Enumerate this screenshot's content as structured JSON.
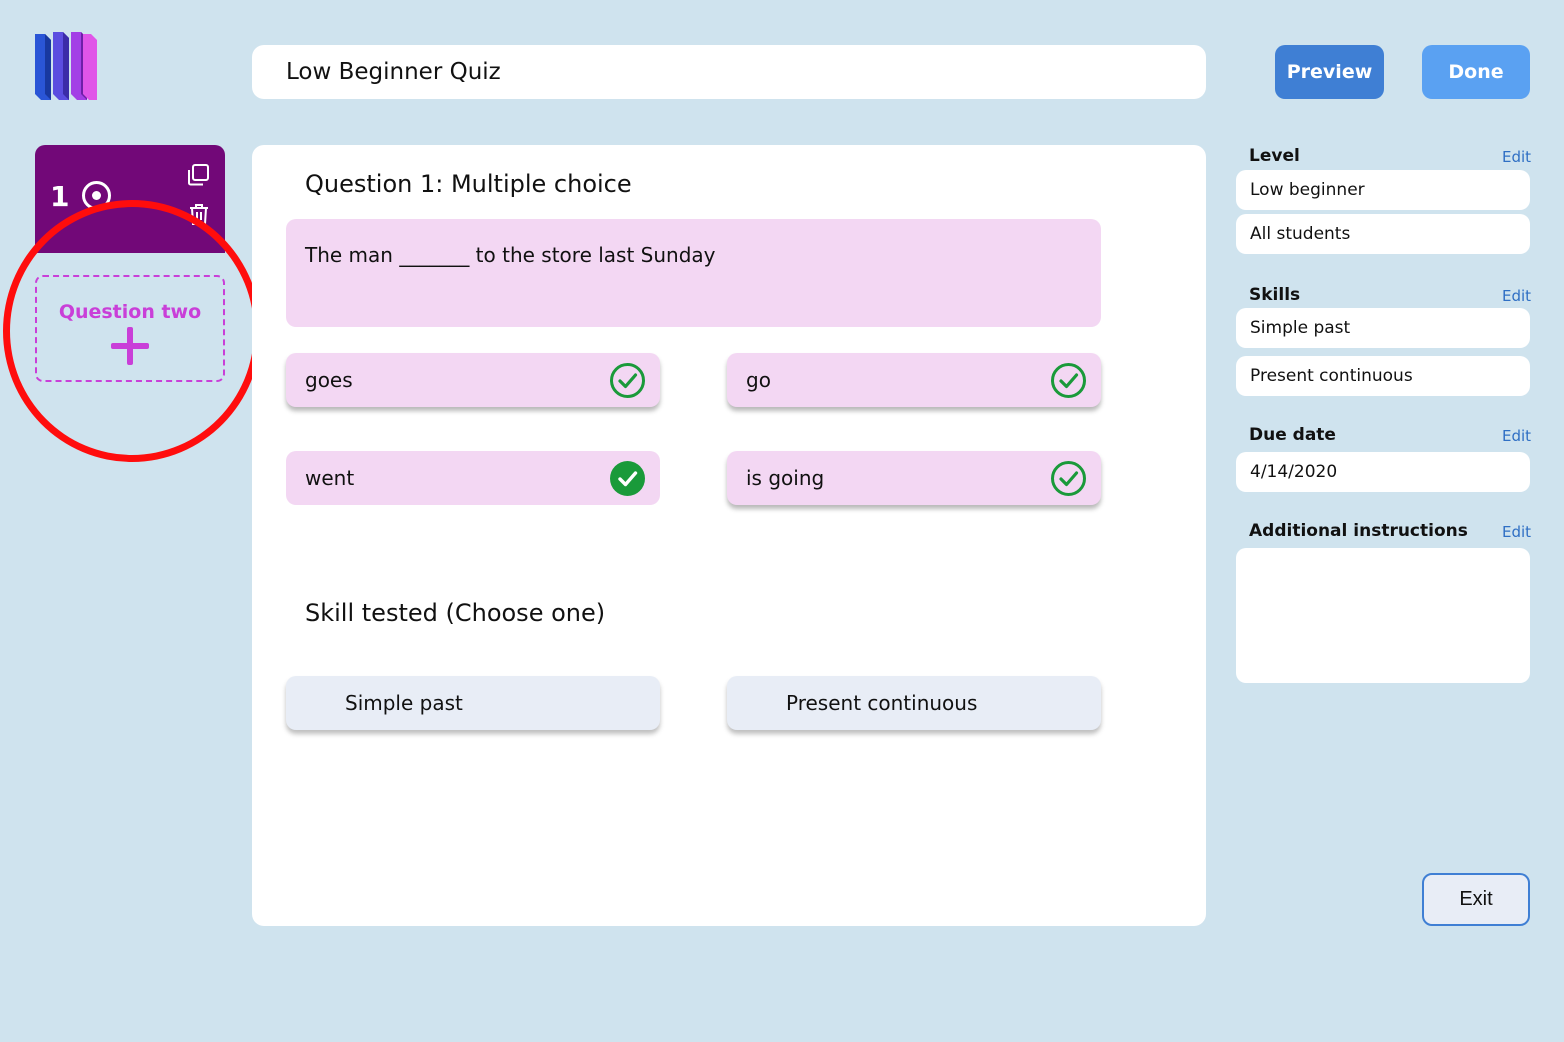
{
  "header": {
    "quiz_title": "Low Beginner Quiz",
    "preview_label": "Preview",
    "done_label": "Done"
  },
  "sidebar": {
    "question_number": "1",
    "add_question_label": "Question two"
  },
  "question": {
    "title": "Question 1: Multiple choice",
    "prompt": "The man _______ to the store last Sunday",
    "choices": [
      {
        "label": "goes",
        "selected": false
      },
      {
        "label": "go",
        "selected": false
      },
      {
        "label": "went",
        "selected": true
      },
      {
        "label": "is going",
        "selected": false
      }
    ]
  },
  "skills_tested": {
    "title": "Skill tested (Choose one)",
    "options": [
      "Simple past",
      "Present continuous"
    ]
  },
  "settings": {
    "edit_label": "Edit",
    "level": {
      "label": "Level",
      "values": [
        "Low beginner",
        "All students"
      ]
    },
    "skills": {
      "label": "Skills",
      "values": [
        "Simple past",
        "Present continuous"
      ]
    },
    "due_date": {
      "label": "Due date",
      "value": "4/14/2020"
    },
    "instructions": {
      "label": "Additional instructions",
      "value": ""
    }
  },
  "footer": {
    "exit_label": "Exit"
  },
  "colors": {
    "background": "#cfe3ee",
    "accent_purple": "#720878",
    "choice_pink": "#f3d7f3",
    "check_green": "#1a9a3a",
    "primary_blue": "#3f7fd4",
    "highlight_red": "#ff0d0d"
  }
}
